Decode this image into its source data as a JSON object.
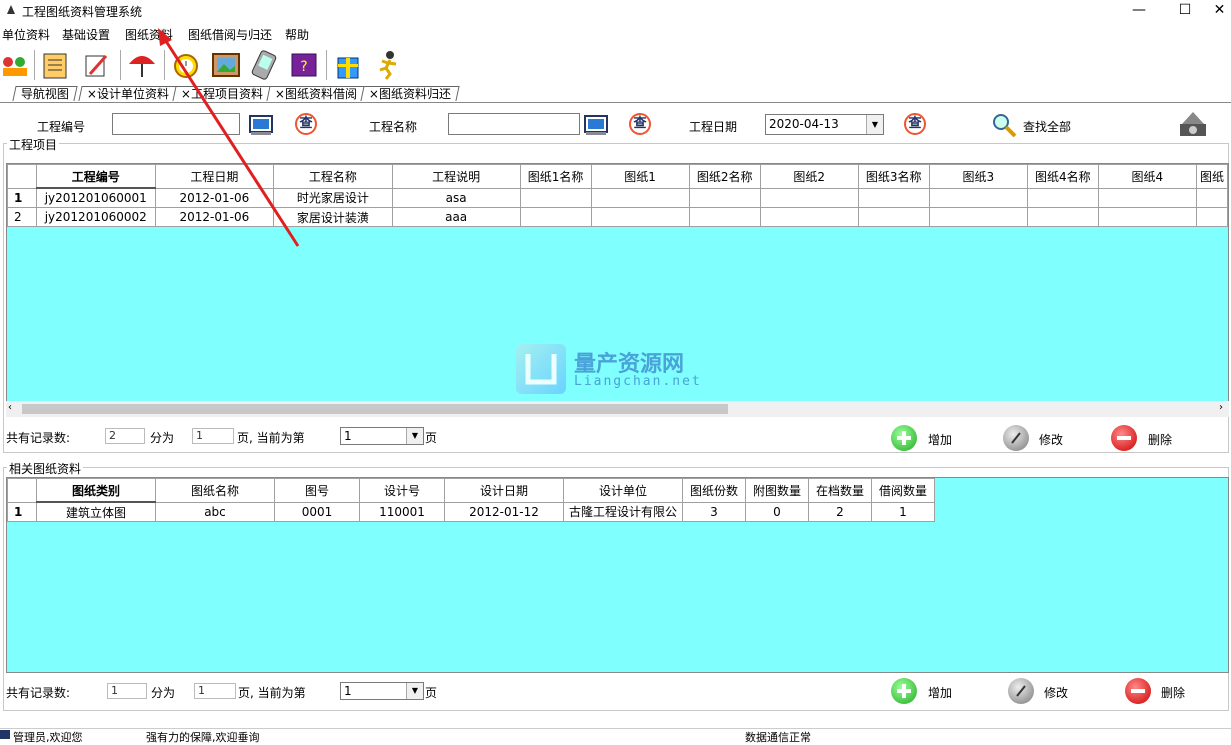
{
  "window": {
    "title": "工程图纸资料管理系统",
    "minimize": "—",
    "maximize": "☐",
    "close": "✕"
  },
  "menu": [
    "单位资料",
    "基础设置",
    "图纸资料",
    "图纸借阅与归还",
    "帮助"
  ],
  "toolbar_icons": [
    "users-icon",
    "book-icon",
    "edit-icon",
    "umbrella-icon",
    "alarm-clock-icon",
    "picture-icon",
    "pda-icon",
    "help-book-icon",
    "gift-icon",
    "runner-icon"
  ],
  "tabs": [
    "导航视图",
    "×设计单位资料",
    "×工程项目资料",
    "×图纸资料借阅",
    "×图纸资料归还"
  ],
  "search": {
    "code_label": "工程编号",
    "name_label": "工程名称",
    "date_label": "工程日期",
    "date_value": "2020-04-13",
    "query_glyph": "查",
    "find_all": "查找全部"
  },
  "project_group": {
    "title": "工程项目",
    "columns": [
      "工程编号",
      "工程日期",
      "工程名称",
      "工程说明",
      "图纸1名称",
      "图纸1",
      "图纸2名称",
      "图纸2",
      "图纸3名称",
      "图纸3",
      "图纸4名称",
      "图纸4",
      "图纸"
    ],
    "rows": [
      {
        "n": "1",
        "cells": [
          "jy201201060001",
          "2012-01-06",
          "时光家居设计",
          "asa",
          "",
          "",
          "",
          "",
          "",
          "",
          "",
          "",
          ""
        ]
      },
      {
        "n": "2",
        "cells": [
          "jy201201060002",
          "2012-01-06",
          "家居设计装潢",
          "aaa",
          "",
          "",
          "",
          "",
          "",
          "",
          "",
          "",
          ""
        ]
      }
    ],
    "pager": {
      "total_label": "共有记录数:",
      "total": "2",
      "split_label": "分为",
      "pages": "1",
      "page_current_label": "页, 当前为第",
      "current": "1",
      "page_suffix": "页",
      "add": "增加",
      "edit": "修改",
      "delete": "删除"
    }
  },
  "drawing_group": {
    "title": "相关图纸资料",
    "columns": [
      "图纸类别",
      "图纸名称",
      "图号",
      "设计号",
      "设计日期",
      "设计单位",
      "图纸份数",
      "附图数量",
      "在档数量",
      "借阅数量"
    ],
    "rows": [
      {
        "n": "1",
        "cells": [
          "建筑立体图",
          "abc",
          "0001",
          "110001",
          "2012-01-12",
          "古隆工程设计有限公",
          "3",
          "0",
          "2",
          "1"
        ]
      }
    ],
    "pager": {
      "total_label": "共有记录数:",
      "total": "1",
      "split_label": "分为",
      "pages": "1",
      "page_current_label": "页, 当前为第",
      "current": "1",
      "page_suffix": "页",
      "add": "增加",
      "edit": "修改",
      "delete": "删除"
    }
  },
  "watermark": {
    "title": "量产资源网",
    "subtitle": "Liangchan.net"
  },
  "status": {
    "user": "管理员,欢迎您",
    "slogan": "强有力的保障,欢迎垂询",
    "connection": "数据通信正常"
  },
  "colors": {
    "grid_bg": "#80ffff",
    "arrow": "#e02020"
  }
}
